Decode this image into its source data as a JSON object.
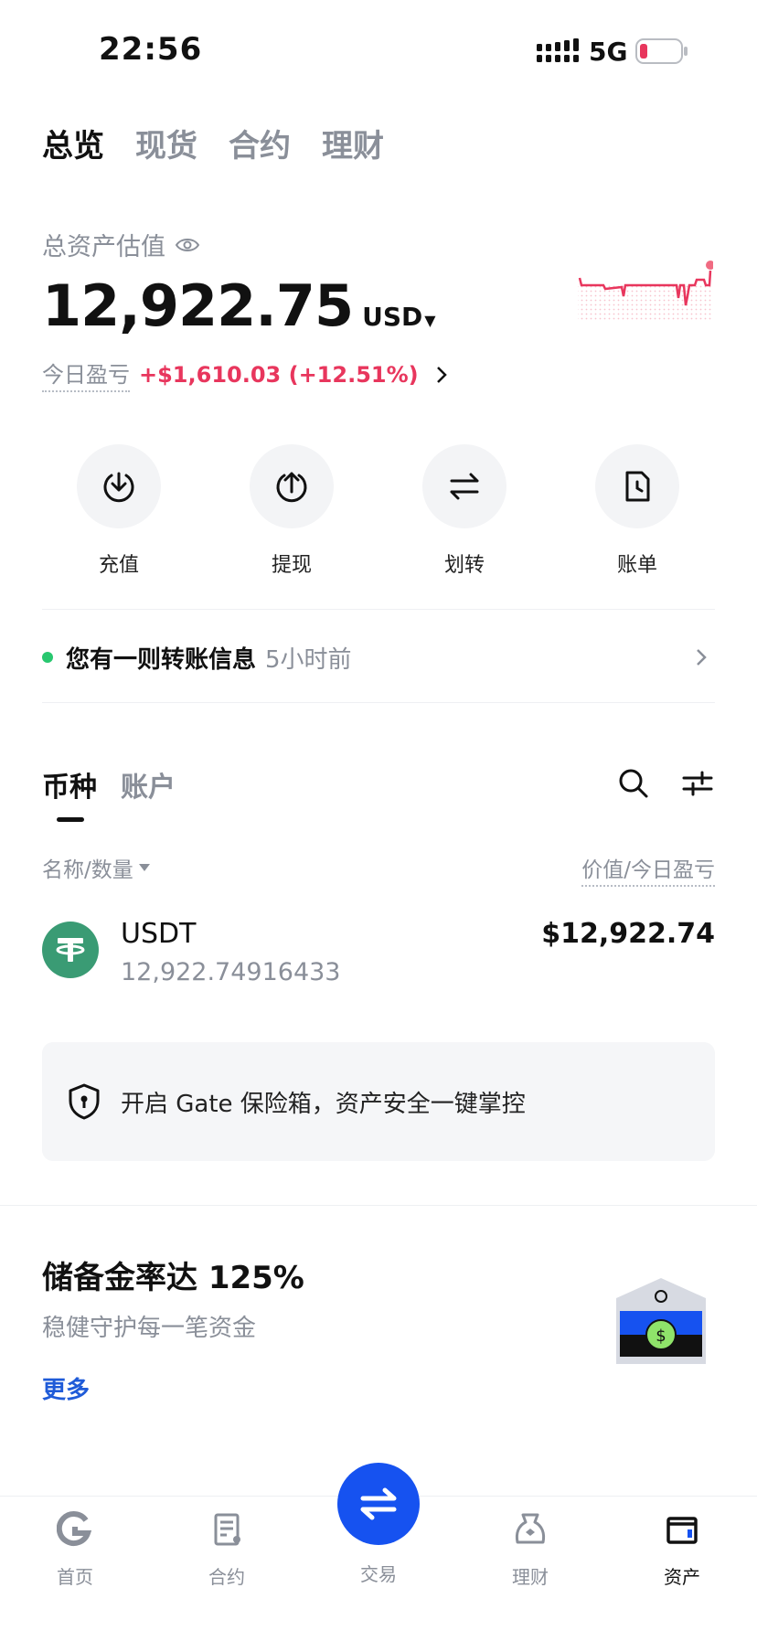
{
  "status_bar": {
    "time": "22:56",
    "network": "5G"
  },
  "top_tabs": [
    {
      "label": "总览",
      "active": true
    },
    {
      "label": "现货",
      "active": false
    },
    {
      "label": "合约",
      "active": false
    },
    {
      "label": "理财",
      "active": false
    }
  ],
  "overview": {
    "total_label": "总资产估值",
    "total_value": "12,922.75",
    "currency": "USD",
    "pnl_label": "今日盈亏",
    "pnl_value": "+$1,610.03 (+12.51%)",
    "pnl_color": "#e8365d"
  },
  "actions": [
    {
      "label": "充值",
      "icon": "deposit-icon"
    },
    {
      "label": "提现",
      "icon": "withdraw-icon"
    },
    {
      "label": "划转",
      "icon": "transfer-icon"
    },
    {
      "label": "账单",
      "icon": "bill-icon"
    }
  ],
  "notice": {
    "text": "您有一则转账信息",
    "time": "5小时前"
  },
  "asset_tabs": [
    {
      "label": "币种",
      "active": true
    },
    {
      "label": "账户",
      "active": false
    }
  ],
  "columns": {
    "left": "名称/数量",
    "right": "价值/今日盈亏"
  },
  "coins": [
    {
      "symbol": "USDT",
      "amount": "12,922.74916433",
      "value": "$12,922.74",
      "logo_color": "#3a9b74"
    }
  ],
  "vault_banner": {
    "text": "开启 Gate 保险箱，资产安全一键掌控"
  },
  "reserve": {
    "title": "储备金率达 125%",
    "subtitle": "稳健守护每一笔资金",
    "more": "更多"
  },
  "bottom_nav": [
    {
      "label": "首页",
      "icon": "home-icon",
      "active": false
    },
    {
      "label": "合约",
      "icon": "futures-icon",
      "active": false
    },
    {
      "label": "交易",
      "icon": "trade-icon",
      "active": false
    },
    {
      "label": "理财",
      "icon": "earn-icon",
      "active": false
    },
    {
      "label": "资产",
      "icon": "wallet-icon",
      "active": true
    }
  ],
  "colors": {
    "accent": "#1652f0",
    "positive_dot": "#28c76f",
    "link": "#1f5bd8"
  }
}
